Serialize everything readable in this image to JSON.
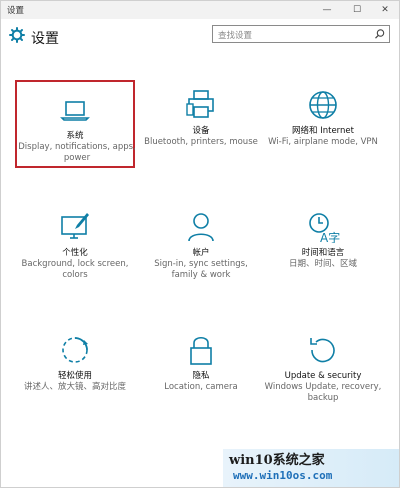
{
  "window": {
    "title": "设置",
    "controls": {
      "minimize": "—",
      "maximize": "☐",
      "close": "✕"
    }
  },
  "header": {
    "title": "设置",
    "search_placeholder": "查找设置"
  },
  "tiles": [
    {
      "id": "system",
      "name": "系统",
      "desc": "Display, notifications, apps, power",
      "icon": "laptop-icon",
      "selected": true
    },
    {
      "id": "devices",
      "name": "设备",
      "desc": "Bluetooth, printers, mouse",
      "icon": "printer-icon",
      "selected": false
    },
    {
      "id": "network",
      "name": "网络和 Internet",
      "desc": "Wi-Fi, airplane mode, VPN",
      "icon": "globe-icon",
      "selected": false
    },
    {
      "id": "personalization",
      "name": "个性化",
      "desc": "Background, lock screen, colors",
      "icon": "paintbrush-monitor-icon",
      "selected": false
    },
    {
      "id": "accounts",
      "name": "帐户",
      "desc": "Sign-in, sync settings, family & work",
      "icon": "person-icon",
      "selected": false
    },
    {
      "id": "time-language",
      "name": "时间和语言",
      "desc": "日期、时间、区域",
      "icon": "clock-language-icon",
      "selected": false
    },
    {
      "id": "ease-of-access",
      "name": "轻松使用",
      "desc": "讲述人、放大镜、高对比度",
      "icon": "ease-of-access-icon",
      "selected": false
    },
    {
      "id": "privacy",
      "name": "隐私",
      "desc": "Location, camera",
      "icon": "lock-icon",
      "selected": false
    },
    {
      "id": "update-security",
      "name": "Update & security",
      "desc": "Windows Update, recovery, backup",
      "icon": "refresh-icon",
      "selected": false
    }
  ],
  "watermark": {
    "brand": "win10系统之家",
    "url": "www.win10os.com"
  },
  "colors": {
    "accent": "#0f7fa6",
    "selection_border": "#c0262d"
  }
}
